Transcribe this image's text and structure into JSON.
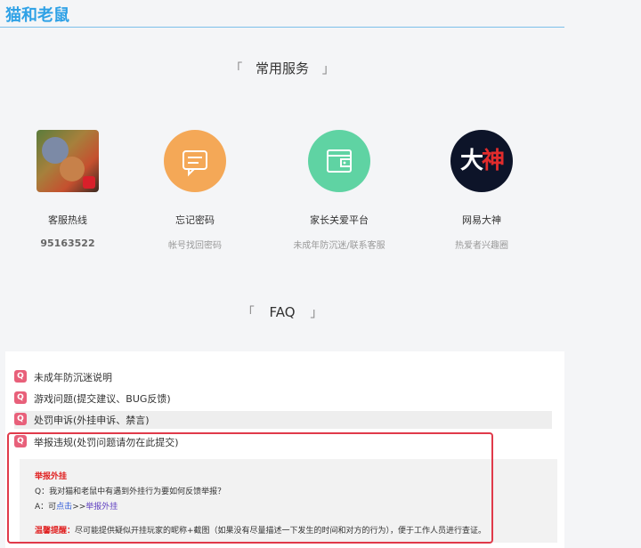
{
  "header": {
    "title": "猫和老鼠"
  },
  "services": {
    "title": "常用服务",
    "bracket_left": "「",
    "bracket_right": "」",
    "items": [
      {
        "name": "客服热线",
        "desc": "95163522",
        "icon": "game-logo-icon"
      },
      {
        "name": "忘记密码",
        "desc": "帐号找回密码",
        "icon": "message-icon"
      },
      {
        "name": "家长关爱平台",
        "desc": "未成年防沉迷/联系客服",
        "icon": "wallet-icon"
      },
      {
        "name": "网易大神",
        "desc": "热爱者兴趣圈",
        "icon": "dashen-icon",
        "icon_text": "大神"
      }
    ]
  },
  "faq": {
    "title": "FAQ",
    "bracket_left": "「",
    "bracket_right": "」",
    "badge": "Q",
    "items": [
      "未成年防沉迷说明",
      "游戏问题(提交建议、BUG反馈)",
      "处罚申诉(外挂申诉、禁言)",
      "举报违规(处罚问题请勿在此提交)"
    ],
    "answer": {
      "heading": "举报外挂",
      "question": "Q：我对猫和老鼠中有遇到外挂行为要如何反馈举报？",
      "answer_prefix": "A：可",
      "answer_link": "点击",
      "answer_arrow": ">>",
      "answer_link2": "举报外挂",
      "tip_label": "温馨提醒：",
      "tip_text": "尽可能提供疑似开挂玩家的昵称+截图（如果没有尽量描述一下发生的时间和对方的行为），便于工作人员进行查证。"
    }
  },
  "colors": {
    "accent": "#2ea1e6",
    "highlight": "#e03a4a",
    "badge": "#e8607a"
  }
}
